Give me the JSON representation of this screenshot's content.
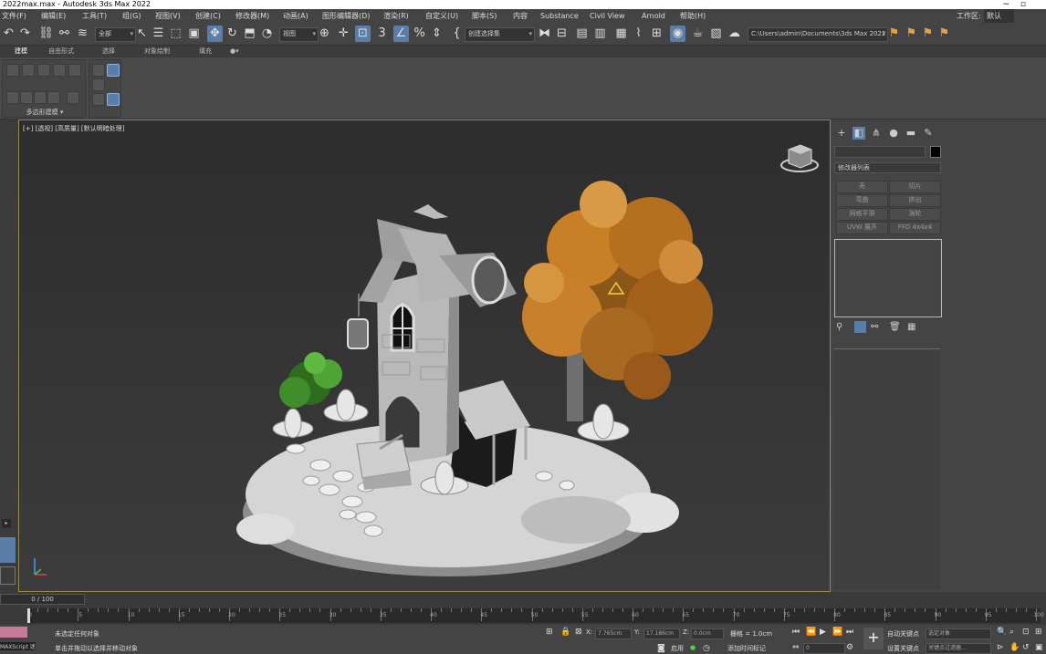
{
  "window": {
    "title": "2022max.max - Autodesk 3ds Max 2022",
    "controls": [
      "−",
      "▫"
    ]
  },
  "menus": [
    "文件(F)",
    "编辑(E)",
    "工具(T)",
    "组(G)",
    "视图(V)",
    "创建(C)",
    "修改器(M)",
    "动画(A)",
    "图形编辑器(D)",
    "渲染(R)",
    "自定义(U)",
    "脚本(S)",
    "内容",
    "Substance",
    "Civil View",
    "Arnold",
    "帮助(H)"
  ],
  "workspace": {
    "label": "工作区:",
    "value": "默认"
  },
  "toolbar": {
    "selection_filter": "全部",
    "reference_coord": "视图",
    "named_selection": "创建选择集",
    "project_path": "C:\\Users\\admin\\Documents\\3ds Max 2022",
    "numbers": [
      "3",
      "%"
    ]
  },
  "ribbon": {
    "tabs": [
      "建模",
      "自由形式",
      "选择",
      "对象绘制",
      "填充"
    ],
    "active_tab": "建模",
    "panel_label": "多边形建模 ▾"
  },
  "viewport": {
    "label": "[+] [透视] [高质量] [默认明暗处理]"
  },
  "command_panel": {
    "modifier_list": "修改器列表",
    "modifier_buttons": [
      "壳",
      "切片",
      "弯曲",
      "挤出",
      "网格平滑",
      "涡轮",
      "UVW 展开",
      "FFD 4x4x4"
    ],
    "colors": {
      "swatch": "#000000",
      "active": "#5a7ea8"
    }
  },
  "timeline": {
    "frame_display": "0 / 100",
    "ticks": [
      0,
      5,
      10,
      15,
      20,
      25,
      30,
      35,
      40,
      45,
      50,
      55,
      60,
      65,
      70,
      75,
      80,
      85,
      90,
      95,
      100
    ]
  },
  "status": {
    "maxscript": "MAXScript 迷",
    "line1": "未选定任何对象",
    "line2": "单击并拖动以选择并移动对象",
    "x_label": "X:",
    "x_value": "7.765cm",
    "y_label": "Y:",
    "y_value": "17.186cm",
    "z_label": "Z:",
    "z_value": "0.0cm",
    "grid": "栅格 = 1.0cm",
    "enabled": "启用",
    "add_time_tag": "添加时间标记",
    "auto_key": "自动关键点",
    "set_key": "设置关键点",
    "selected_object": "选定对象",
    "key_filters": "关键点过滤器...",
    "frame_field": "0"
  }
}
